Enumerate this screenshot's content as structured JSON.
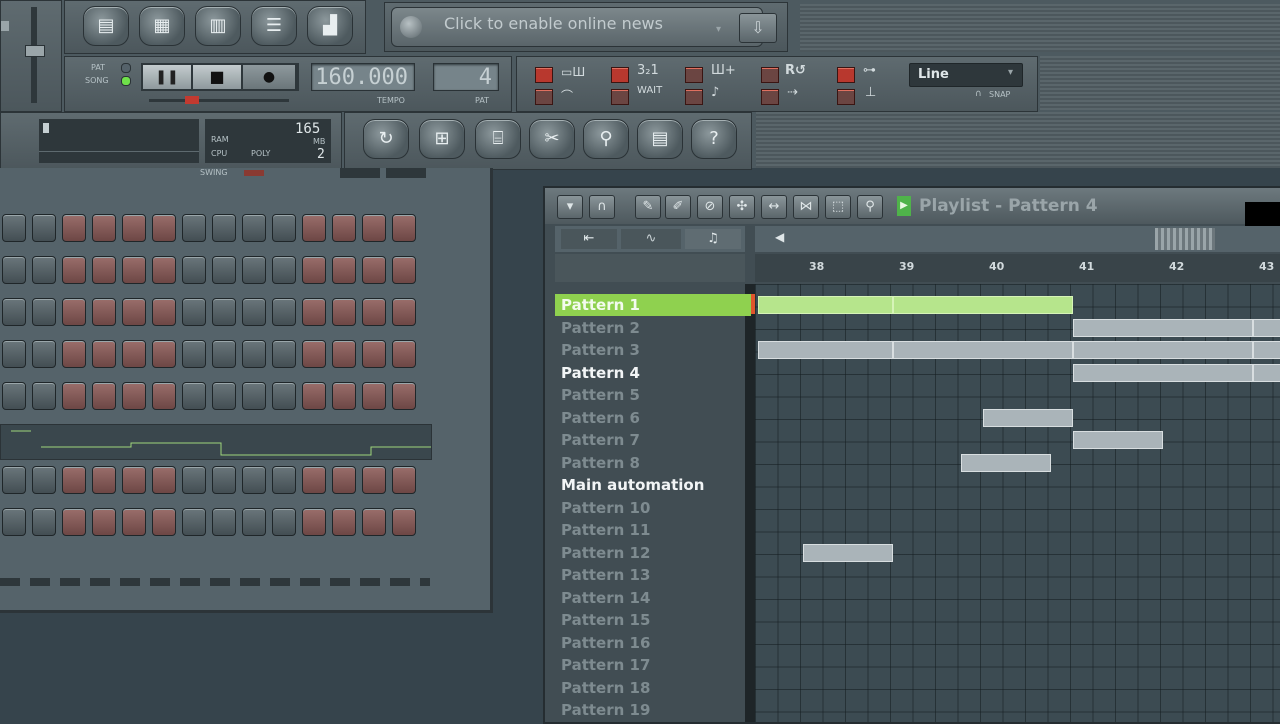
{
  "news": {
    "text": "Click to enable online news"
  },
  "transport": {
    "pat_label": "PAT",
    "song_label": "SONG",
    "tempo_value": "160.000",
    "tempo_label": "TEMPO",
    "pattern_value": "4",
    "pattern_label": "PAT"
  },
  "record_panel": {
    "snap_mode": "Line",
    "snap_label": "SNAP"
  },
  "monitor": {
    "ram_label": "RAM",
    "cpu_label": "CPU",
    "poly_label": "POLY",
    "mem_value": "165",
    "mb_label": "MB",
    "poly_value": "2"
  },
  "stepseq": {
    "swing_label": "SWING"
  },
  "playlist": {
    "title": "Playlist - Pattern 4",
    "ruler": [
      "38",
      "39",
      "40",
      "41",
      "42",
      "43"
    ],
    "tracks": [
      {
        "label": "Pattern 1",
        "state": "selected"
      },
      {
        "label": "Pattern 2",
        "state": "dim"
      },
      {
        "label": "Pattern 3",
        "state": "dim"
      },
      {
        "label": "Pattern 4",
        "state": "active"
      },
      {
        "label": "Pattern 5",
        "state": "dim"
      },
      {
        "label": "Pattern 6",
        "state": "dim"
      },
      {
        "label": "Pattern 7",
        "state": "dim"
      },
      {
        "label": "Pattern 8",
        "state": "dim"
      },
      {
        "label": "Main automation",
        "state": "active"
      },
      {
        "label": "Pattern 10",
        "state": "dim"
      },
      {
        "label": "Pattern 11",
        "state": "dim"
      },
      {
        "label": "Pattern 12",
        "state": "dim"
      },
      {
        "label": "Pattern 13",
        "state": "dim"
      },
      {
        "label": "Pattern 14",
        "state": "dim"
      },
      {
        "label": "Pattern 15",
        "state": "dim"
      },
      {
        "label": "Pattern 16",
        "state": "dim"
      },
      {
        "label": "Pattern 17",
        "state": "dim"
      },
      {
        "label": "Pattern 18",
        "state": "dim"
      },
      {
        "label": "Pattern 19",
        "state": "dim"
      }
    ]
  },
  "colors": {
    "selected_track": "#8fd14f",
    "clip_green": "#b6e58c",
    "clip_gray": "#aab4b9",
    "step_red": "#9a6e6b"
  }
}
